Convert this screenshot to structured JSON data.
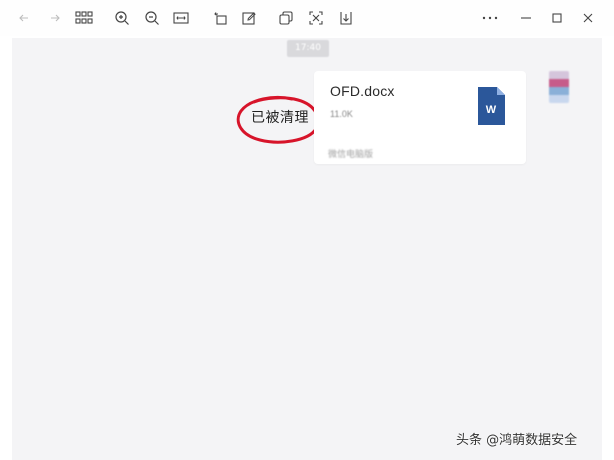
{
  "toolbar": {
    "buttons": [
      {
        "id": "back",
        "icon": "arrow-left-icon"
      },
      {
        "id": "forward",
        "icon": "arrow-right-icon"
      },
      {
        "id": "grid",
        "icon": "grid-icon"
      },
      {
        "id": "zoom-in",
        "icon": "zoom-in-icon"
      },
      {
        "id": "zoom-out",
        "icon": "zoom-out-icon"
      },
      {
        "id": "fit",
        "icon": "fit-width-icon"
      },
      {
        "id": "rotate",
        "icon": "rotate-icon"
      },
      {
        "id": "edit",
        "icon": "edit-icon"
      },
      {
        "id": "copy",
        "icon": "copy-icon"
      },
      {
        "id": "screenshot",
        "icon": "scan-icon"
      },
      {
        "id": "download",
        "icon": "download-icon"
      }
    ]
  },
  "window_controls": {
    "more": "more-icon",
    "minimize": "minimize-icon",
    "maximize": "maximize-icon",
    "close": "close-icon"
  },
  "chat": {
    "timestamp": "17:40",
    "file": {
      "name": "OFD.docx",
      "size": "11.0K",
      "source": "微信电脑版",
      "icon": "word-doc-icon",
      "icon_letter": "W",
      "icon_color": "#2b579a"
    },
    "status": "已被清理",
    "highlight_color": "#d7142a"
  },
  "watermark": "头条 @鸿萌数据安全"
}
